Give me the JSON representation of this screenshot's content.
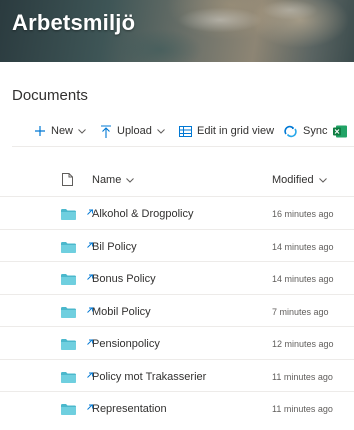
{
  "site": {
    "title": "Arbetsmiljö"
  },
  "library": {
    "title": "Documents"
  },
  "commands": {
    "new": "New",
    "upload": "Upload",
    "grid": "Edit in grid view",
    "sync": "Sync"
  },
  "columns": {
    "name": "Name",
    "modified": "Modified"
  },
  "items": [
    {
      "name": "Alkohol & Drogpolicy",
      "modified": "16 minutes ago"
    },
    {
      "name": "Bil Policy",
      "modified": "14 minutes ago"
    },
    {
      "name": "Bonus Policy",
      "modified": "14 minutes ago"
    },
    {
      "name": "Mobil Policy",
      "modified": "7 minutes ago"
    },
    {
      "name": "Pensionpolicy",
      "modified": "12 minutes ago"
    },
    {
      "name": "Policy mot Trakasserier",
      "modified": "11 minutes ago"
    },
    {
      "name": "Representation",
      "modified": "11 minutes ago"
    }
  ],
  "colors": {
    "accent": "#0078d4",
    "folder": "#5cc0d1",
    "excel": "#217346"
  },
  "icons": [
    "plus-icon",
    "chevron-down-icon",
    "upload-icon",
    "grid-icon",
    "sync-icon",
    "excel-icon",
    "file-icon",
    "folder-icon",
    "new-item-icon"
  ]
}
